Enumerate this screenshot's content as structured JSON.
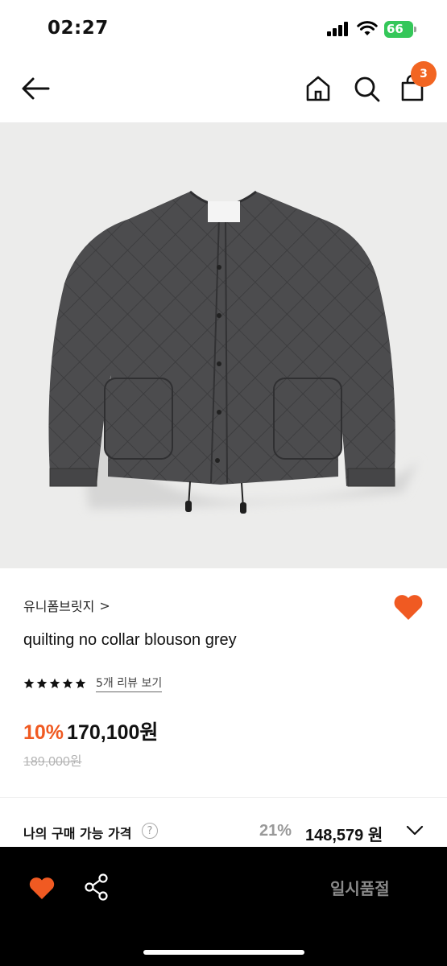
{
  "status_bar": {
    "time": "02:27",
    "battery": "66"
  },
  "nav": {
    "cart_count": "3"
  },
  "product": {
    "brand": "유니폼브릿지",
    "brand_chevron": ">",
    "name": "quilting no collar blouson grey",
    "rating_stars": 5,
    "review_link": "5개 리뷰 보기",
    "discount_rate": "10%",
    "sale_price": "170,100원",
    "original_price": "189,000원"
  },
  "purchase": {
    "label": "나의 구매 가능 가격",
    "help": "?",
    "discount_rate": "21%",
    "price": "148,579 원"
  },
  "bottom_bar": {
    "status_button": "일시품절"
  },
  "colors": {
    "accent": "#f05a22",
    "battery": "#34c759",
    "image_background": "#ececeb"
  }
}
